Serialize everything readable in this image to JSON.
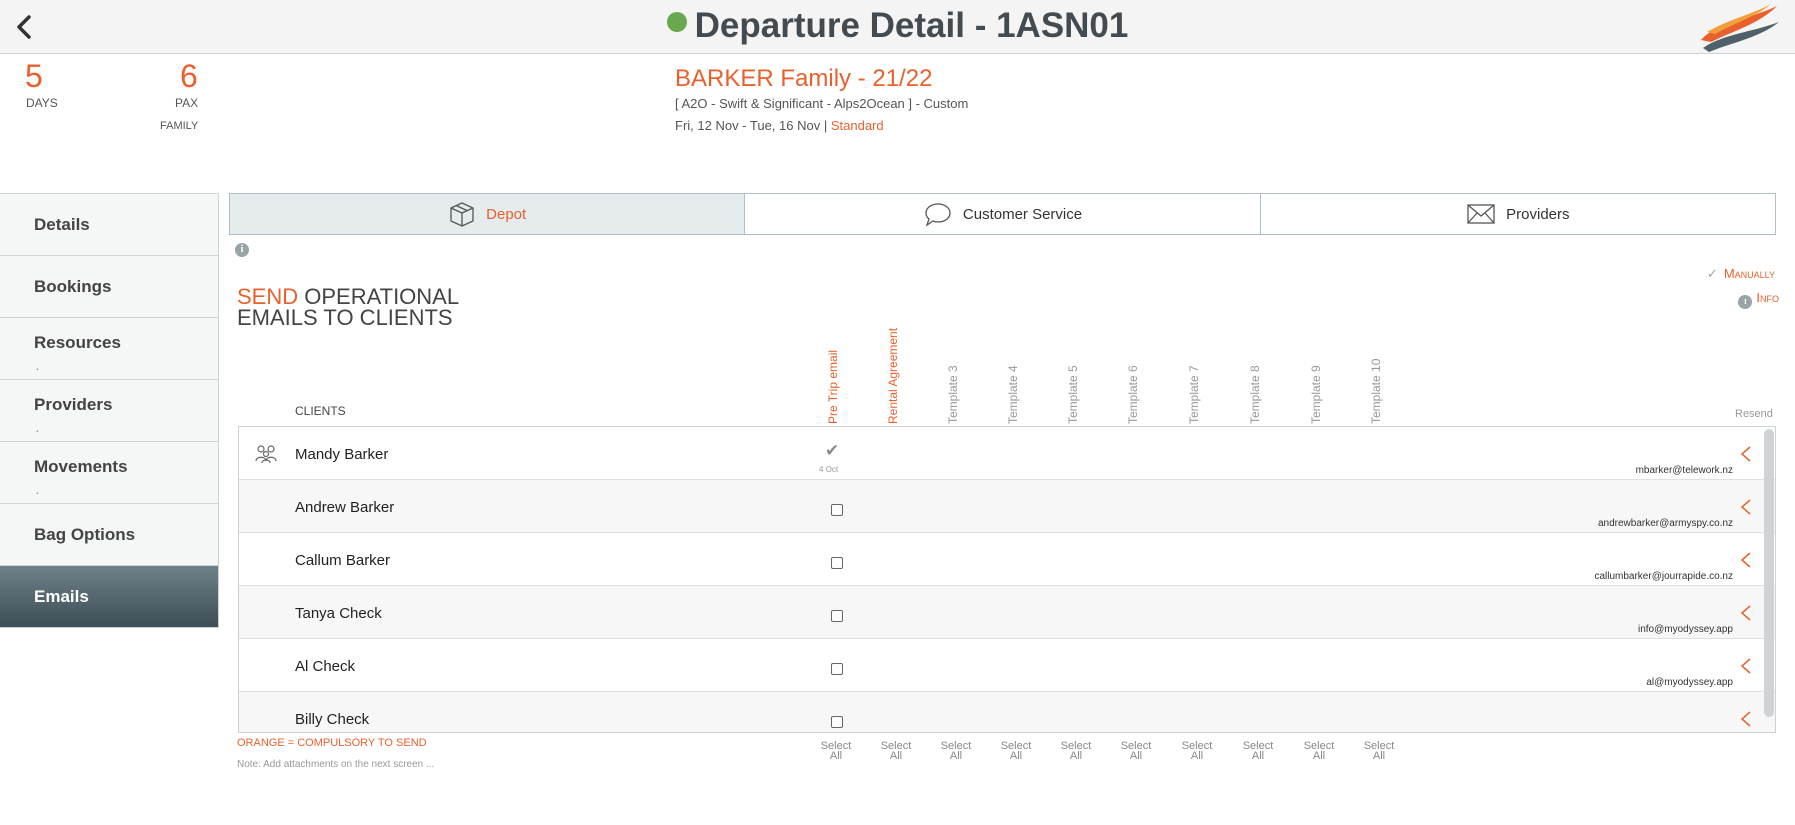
{
  "header": {
    "title": "Departure Detail - 1ASN01",
    "status_color": "#6aa84f",
    "back_icon": "chevron-left-icon",
    "logo_icon": "swoosh-logo"
  },
  "summary": {
    "days_value": "5",
    "days_label": "DAYS",
    "pax_value": "6",
    "pax_label": "PAX",
    "pax_type": "FAMILY",
    "family_title": "BARKER Family - 21/22",
    "product": "[ A2O - Swift & Significant - Alps2Ocean ] - Custom",
    "dates": "Fri, 12 Nov  - Tue, 16 Nov  |",
    "grade": "Standard"
  },
  "sidebar": {
    "items": [
      {
        "label": "Details"
      },
      {
        "label": "Bookings"
      },
      {
        "label": "Resources"
      },
      {
        "label": "Providers"
      },
      {
        "label": "Movements"
      },
      {
        "label": "Bag Options"
      },
      {
        "label": "Emails"
      }
    ],
    "sub_marker": "."
  },
  "tabs": [
    {
      "label": "Depot",
      "icon": "box-icon"
    },
    {
      "label": "Customer Service",
      "icon": "speech-bubble-icon"
    },
    {
      "label": "Providers",
      "icon": "envelope-icon"
    }
  ],
  "section": {
    "title_orange": "SEND",
    "title_rest_line1": " OPERATIONAL",
    "title_line2": "EMAILS TO CLIENTS"
  },
  "legend": {
    "check_mark": "✓",
    "manually": "Manually",
    "info": "Info"
  },
  "table": {
    "clients_header": "CLIENTS",
    "resend_header": "Resend",
    "columns": [
      "Pre Trip email",
      "Rental Agreement",
      "Template 3",
      "Template 4",
      "Template 5",
      "Template 6",
      "Template 7",
      "Template 8",
      "Template 9",
      "Template 10"
    ],
    "rows": [
      {
        "name": "Mandy Barker",
        "email": "mbarker@telework.nz",
        "sent_mark": "✔",
        "sent_date": "4 Oct"
      },
      {
        "name": "Andrew Barker",
        "email": "andrewbarker@armyspy.co.nz"
      },
      {
        "name": "Callum Barker",
        "email": "callumbarker@jourrapide.co.nz"
      },
      {
        "name": "Tanya Check",
        "email": "info@myodyssey.app"
      },
      {
        "name": "Al Check",
        "email": "al@myodyssey.app"
      },
      {
        "name": "Billy Check",
        "email": ""
      }
    ]
  },
  "footer": {
    "compulsory": "ORANGE = COMPULSORY TO SEND",
    "note": "Note: Add attachments on the next screen ...",
    "select_all_line1": "Select",
    "select_all_line2": "All"
  },
  "colors": {
    "accent": "#e8612c",
    "active_sidebar": "#4f6068"
  }
}
